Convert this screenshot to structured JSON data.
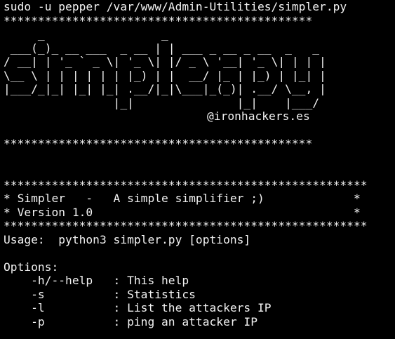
{
  "command": "sudo -u pepper /var/www/Admin-Utilities/simpler.py",
  "separator_short": "*********************************************",
  "logo_lines": [
    "     _                 _",
    " ___(_)_ __ ___  _ __ | | ___ _ __ _ __  _   _",
    "/ __| | '_ ` _ \\| '_ \\| |/ _ \\ '__| '_ \\| | | |",
    "\\__ \\ | | | | | | |_) | |  __/ |_ | |_) | |_| |",
    "|___/_|_| |_| |_| .__/|_|\\___|_(_)| .__/ \\__, |",
    "                |_|               |_|    |___/"
  ],
  "credit": "@ironhackers.es",
  "separator_long": "*****************************************************",
  "box": {
    "line1": "* Simpler   -   A simple simplifier ;)             *",
    "line2": "* Version 1.0                                      *"
  },
  "usage": "Usage:  python3 simpler.py [options]",
  "options_header": "Options:",
  "options": [
    "    -h/--help   : This help",
    "    -s          : Statistics",
    "    -l          : List the attackers IP",
    "    -p          : ping an attacker IP"
  ],
  "colors": {
    "background": "#000000",
    "foreground": "#f2f2f2"
  }
}
